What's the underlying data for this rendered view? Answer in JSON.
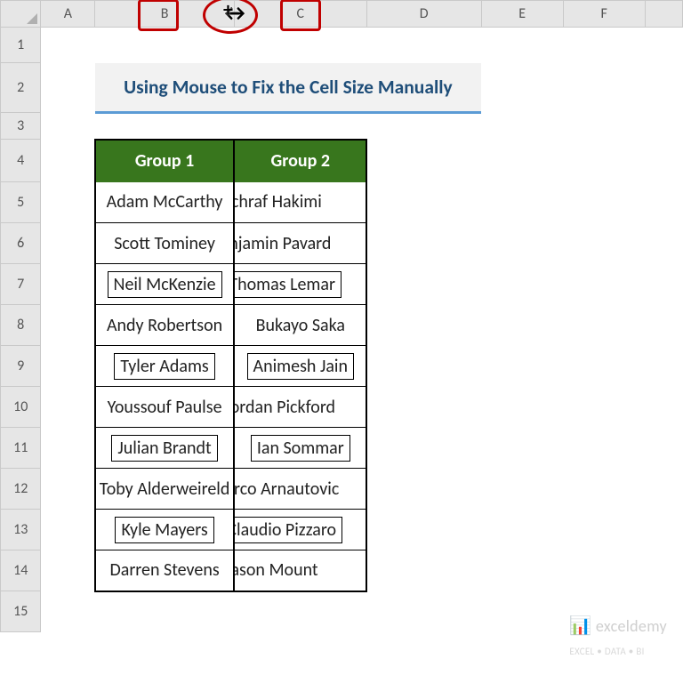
{
  "columns": {
    "A": "A",
    "B": "B",
    "C": "C",
    "D": "D",
    "E": "E",
    "F": "F"
  },
  "rows": [
    "1",
    "2",
    "3",
    "4",
    "5",
    "6",
    "7",
    "8",
    "9",
    "10",
    "11",
    "12",
    "13",
    "14",
    "15"
  ],
  "title": "Using Mouse to Fix the Cell Size Manually",
  "headers": {
    "b4": "Group 1",
    "c4": "Group 2"
  },
  "data": {
    "b5": "Adam McCarthy",
    "c5": "Achraf Hakimi",
    "b6": "Scott Tominey",
    "c6": "Benjamin Pavard",
    "b7": "Neil McKenzie",
    "c7": "Thomas Lemar",
    "b8": "Andy Robertson",
    "c8": "Bukayo Saka",
    "b9": "Tyler Adams",
    "c9": "Animesh Jain",
    "b10": "Youssouf Paulse",
    "c10": "Jordan Pickford",
    "b11": "Julian Brandt",
    "c11": "Ian Sommar",
    "b12": "Toby Alderweireld",
    "c12": "Marco Arnautovic",
    "b13": "Kyle Mayers",
    "c13": "Claudio Pizzaro",
    "b14": "Darren Stevens",
    "c14": "Mason Mount"
  },
  "watermark": {
    "brand": "exceldemy",
    "tag": "EXCEL • DATA • BI"
  },
  "cursor_glyph": "✢",
  "chart_data": {
    "type": "table",
    "title": "Using Mouse to Fix the Cell Size Manually",
    "columns": [
      "Group 1",
      "Group 2"
    ],
    "rows": [
      [
        "Adam McCarthy",
        "Achraf Hakimi"
      ],
      [
        "Scott Tominey",
        "Benjamin Pavard"
      ],
      [
        "Neil McKenzie",
        "Thomas Lemar"
      ],
      [
        "Andy Robertson",
        "Bukayo Saka"
      ],
      [
        "Tyler Adams",
        "Animesh Jain"
      ],
      [
        "Youssouf Paulse",
        "Jordan Pickford"
      ],
      [
        "Julian Brandt",
        "Ian Sommar"
      ],
      [
        "Toby Alderweireld",
        "Marco Arnautovic"
      ],
      [
        "Kyle Mayers",
        "Claudio Pizzaro"
      ],
      [
        "Darren Stevens",
        "Mason Mount"
      ]
    ]
  }
}
